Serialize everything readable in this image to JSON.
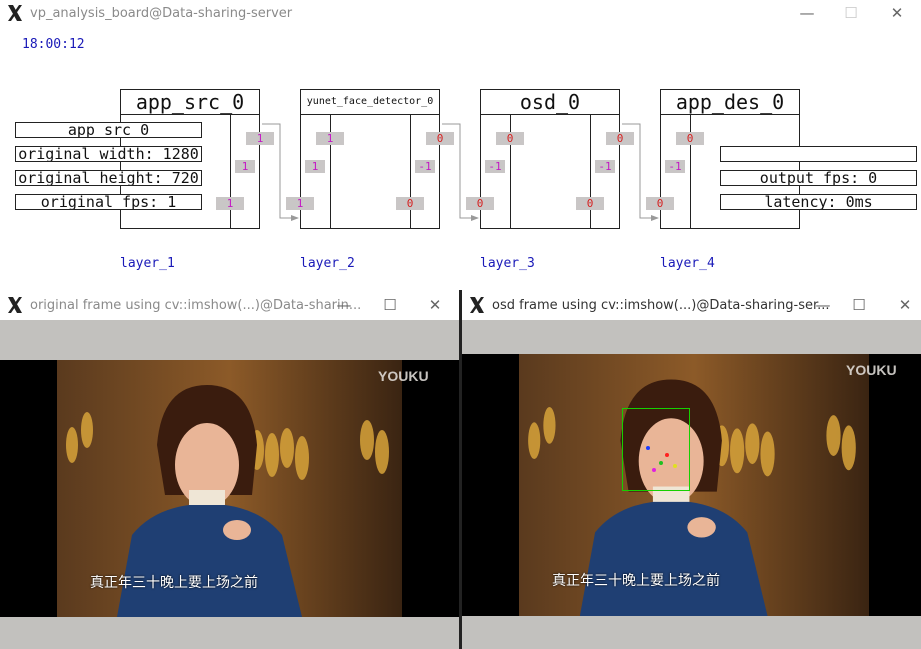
{
  "board_window": {
    "title": "vp_analysis_board@Data-sharing-server",
    "clock": "18:00:12"
  },
  "nodes": [
    {
      "title": "app_src_0",
      "in_port": "1",
      "out_ports": [
        "1",
        "1",
        "1"
      ]
    },
    {
      "title": "yunet_face_detector_0",
      "in_ports": [
        "1",
        "1",
        "1"
      ],
      "out_ports": [
        "0",
        "-1",
        "0"
      ]
    },
    {
      "title": "osd_0",
      "in_ports": [
        "0",
        "-1",
        "0"
      ],
      "out_ports": [
        "0",
        "-1",
        "0"
      ]
    },
    {
      "title": "app_des_0",
      "in_ports": [
        "0",
        "-1",
        "0"
      ]
    }
  ],
  "src_info": [
    "app_src_0",
    "original_width: 1280",
    "original_height: 720",
    "original_fps: 1"
  ],
  "des_info": [
    "",
    "output_fps: 0",
    "latency: 0ms"
  ],
  "layers": [
    "layer_1",
    "layer_2",
    "layer_3",
    "layer_4"
  ],
  "original_window": {
    "title": "original frame using cv::imshow(...)@Data-sharin...",
    "watermark": "YOUKU",
    "subtitle": "真正年三十晚上要上场之前"
  },
  "osd_window": {
    "title": "osd frame using cv::imshow(...)@Data-sharing-ser...",
    "watermark": "YOUKU",
    "subtitle": "真正年三十晚上要上场之前",
    "face_box_color": "#16d000"
  }
}
